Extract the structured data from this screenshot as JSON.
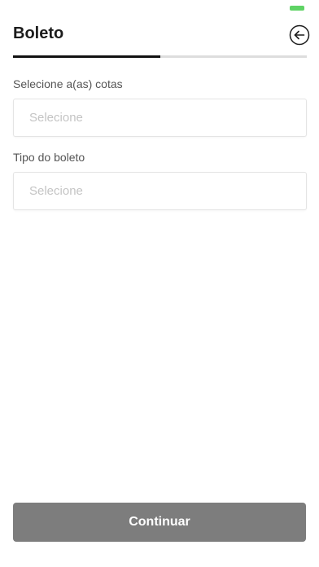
{
  "status_bar": {
    "indicator_color": "#5fd365"
  },
  "header": {
    "title": "Boleto",
    "back_icon": "arrow-left-circle-icon"
  },
  "progress": {
    "value": 0.5
  },
  "form": {
    "fields": [
      {
        "label": "Selecione a(as) cotas",
        "placeholder": "Selecione"
      },
      {
        "label": "Tipo do boleto",
        "placeholder": "Selecione"
      }
    ]
  },
  "footer": {
    "continue_label": "Continuar"
  }
}
